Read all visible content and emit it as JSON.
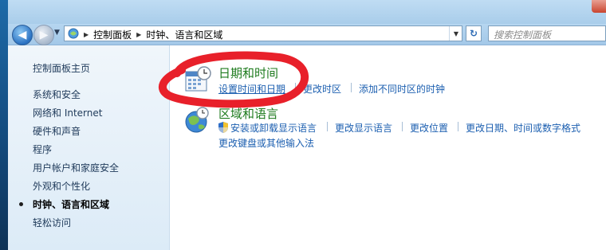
{
  "search": {
    "placeholder": "搜索控制面板"
  },
  "breadcrumb": [
    "控制面板",
    "时钟、语言和区域"
  ],
  "sidebar": {
    "home": "控制面板主页",
    "items": [
      "系统和安全",
      "网络和 Internet",
      "硬件和声音",
      "程序",
      "用户帐户和家庭安全",
      "外观和个性化",
      "时钟、语言和区域",
      "轻松访问"
    ],
    "active_index": 6
  },
  "categories": {
    "datetime": {
      "title": "日期和时间",
      "links": [
        "设置时间和日期",
        "更改时区",
        "添加不同时区的时钟"
      ]
    },
    "region": {
      "title": "区域和语言",
      "links": [
        "安装或卸载显示语言",
        "更改显示语言",
        "更改位置",
        "更改日期、时间或数字格式"
      ],
      "links2": [
        "更改键盘或其他输入法"
      ]
    }
  },
  "annotation": {
    "color": "#e8202a"
  },
  "icons": {
    "back": "back-arrow-icon",
    "forward": "forward-arrow-icon",
    "refresh": "refresh-icon",
    "control_panel": "control-panel-icon",
    "calendar": "calendar-clock-icon",
    "globe": "globe-clock-icon",
    "shield": "uac-shield-icon"
  }
}
